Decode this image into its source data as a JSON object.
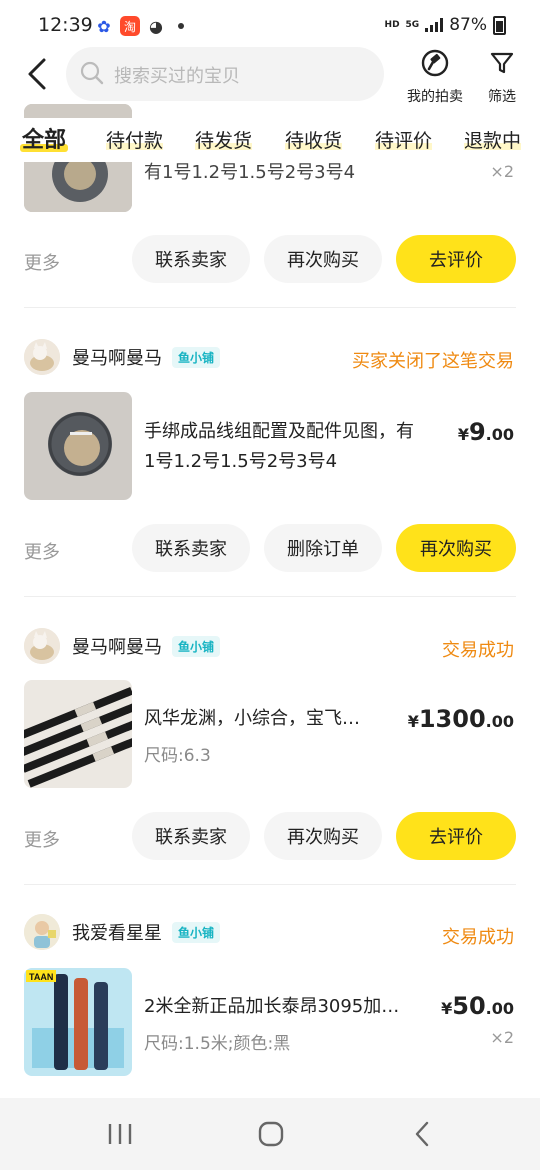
{
  "status_bar": {
    "time": "12:39",
    "network": "HD",
    "cell": "5G",
    "battery": "87%"
  },
  "header": {
    "search_placeholder": "搜索买过的宝贝",
    "my_auction": "我的拍卖",
    "filter": "筛选"
  },
  "tabs": [
    "全部",
    "待付款",
    "待发货",
    "待收货",
    "待评价",
    "退款中"
  ],
  "partial_order": {
    "title_fragment": "有1号1.2号1.5号2号3号4",
    "qty": "×2",
    "more": "更多",
    "buttons": [
      "联系卖家",
      "再次购买",
      "去评价"
    ]
  },
  "orders": [
    {
      "shop": "曼马啊曼马",
      "badge": "鱼小铺",
      "status": "买家关闭了这笔交易",
      "title_line1": "手绑成品线组配置及配件见图，有",
      "title_line2": "1号1.2号1.5号2号3号4",
      "spec": "",
      "price_currency": "¥",
      "price_int": "9",
      "price_dec": ".00",
      "qty": "",
      "more": "更多",
      "buttons": [
        "联系卖家",
        "删除订单",
        "再次购买"
      ]
    },
    {
      "shop": "曼马啊曼马",
      "badge": "鱼小铺",
      "status": "交易成功",
      "title_line1": "风华龙渊，小综合，宝飞…",
      "title_line2": "",
      "spec": "尺码:6.3",
      "price_currency": "¥",
      "price_int": "1300",
      "price_dec": ".00",
      "qty": "",
      "more": "更多",
      "buttons": [
        "联系卖家",
        "再次购买",
        "去评价"
      ]
    },
    {
      "shop": "我爱看星星",
      "badge": "鱼小铺",
      "status": "交易成功",
      "title_line1": "2米全新正品加长泰昂3095加…",
      "title_line2": "",
      "spec": "尺码:1.5米;颜色:黑",
      "price_currency": "¥",
      "price_int": "50",
      "price_dec": ".00",
      "qty": "×2",
      "thumb_label": "TAAN"
    }
  ],
  "colors": {
    "accent_yellow": "#ffe21a",
    "status_orange": "#ef8a12",
    "badge_cyan": "#16b3c2"
  }
}
